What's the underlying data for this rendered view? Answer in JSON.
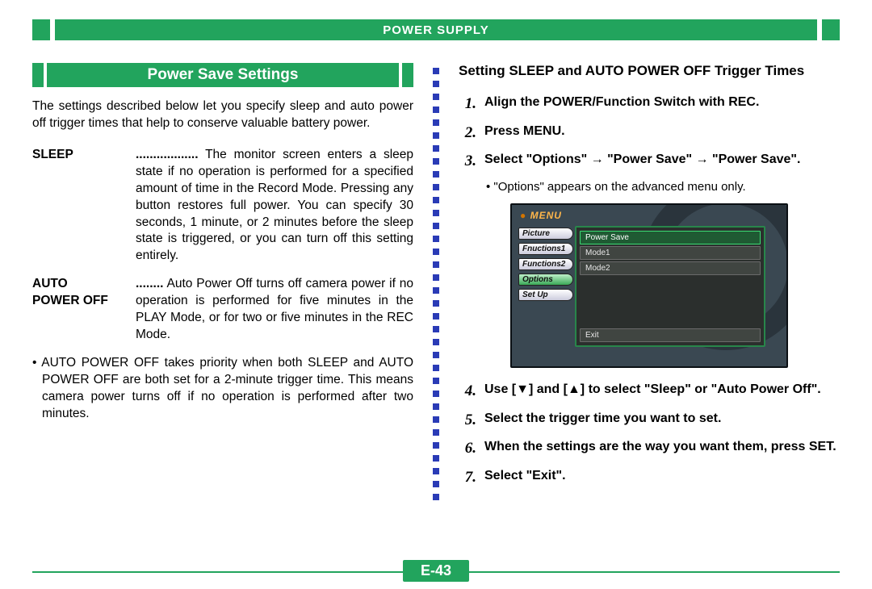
{
  "header": {
    "chapter": "POWER SUPPLY"
  },
  "page_number": "E-43",
  "left": {
    "section_title": "Power Save Settings",
    "intro": "The settings described below let you specify sleep and auto power off trigger times that help to conserve valuable battery power.",
    "defs": [
      {
        "term": "SLEEP",
        "dots": "..................",
        "def": "The monitor screen enters a sleep state if no operation is performed for a specified amount of time in the Record Mode. Pressing any button restores full power. You can specify 30 seconds, 1 minute, or 2 minutes before the sleep state is triggered, or you can turn off this setting entirely."
      },
      {
        "term": "AUTO\nPOWER OFF",
        "dots": "........",
        "def": "Auto Power Off turns off camera power if no operation is performed for five minutes in the PLAY Mode, or for two or five minutes in the REC Mode."
      }
    ],
    "note": "• AUTO POWER OFF takes priority when both SLEEP and AUTO POWER OFF are both set for a 2-minute trigger time. This means camera power turns off if no operation is performed after two minutes."
  },
  "right": {
    "title": "Setting SLEEP and AUTO POWER OFF Trigger Times",
    "steps": [
      {
        "n": "1.",
        "t": "Align the POWER/Function Switch with REC."
      },
      {
        "n": "2.",
        "t": "Press MENU."
      },
      {
        "n": "3.",
        "t": "Select \"Options\" → \"Power Save\" → \"Power Save\"."
      },
      {
        "n": "4.",
        "t": "Use [▼] and [▲] to select \"Sleep\" or \"Auto Power Off\"."
      },
      {
        "n": "5.",
        "t": "Select the trigger time you want to set."
      },
      {
        "n": "6.",
        "t": "When the settings are the way you want them, press SET."
      },
      {
        "n": "7.",
        "t": "Select \"Exit\"."
      }
    ],
    "sub_after_3": "• \"Options\" appears on the advanced menu only.",
    "menu": {
      "header": "MENU",
      "tabs": [
        "Picture",
        "Fnuctions1",
        "Functions2",
        "Options",
        "Set Up"
      ],
      "active_tab_index": 3,
      "items": [
        "Power Save",
        "Mode1",
        "Mode2"
      ],
      "selected_index": 0,
      "exit": "Exit"
    }
  }
}
